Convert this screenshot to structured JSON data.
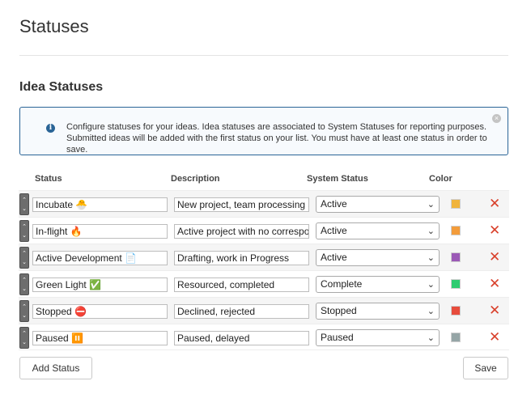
{
  "page_title": "Statuses",
  "section_title": "Idea Statuses",
  "info": {
    "icon": "info-icon",
    "text": "Configure statuses for your ideas. Idea statuses are associated to System Statuses for reporting purposes. Submitted ideas will be added with the first status on your list. You must have at least one status in order to save."
  },
  "columns": {
    "status": "Status",
    "description": "Description",
    "system_status": "System Status",
    "color": "Color"
  },
  "rows": [
    {
      "name": "Incubate 🐣",
      "description": "New project, team processing a",
      "system_status": "Active",
      "color": "#f0b43c"
    },
    {
      "name": "In-flight 🔥",
      "description": "Active project with no correspo",
      "system_status": "Active",
      "color": "#f39c3b"
    },
    {
      "name": "Active Development 📄",
      "description": "Drafting, work in Progress",
      "system_status": "Active",
      "color": "#9b59b6"
    },
    {
      "name": "Green Light ✅",
      "description": "Resourced, completed",
      "system_status": "Complete",
      "color": "#2ecc71"
    },
    {
      "name": "Stopped ⛔",
      "description": "Declined, rejected",
      "system_status": "Stopped",
      "color": "#e74c3c"
    },
    {
      "name": "Paused ⏸️",
      "description": "Paused, delayed",
      "system_status": "Paused",
      "color": "#95a5a6"
    }
  ],
  "buttons": {
    "add_status": "Add Status",
    "save": "Save"
  }
}
